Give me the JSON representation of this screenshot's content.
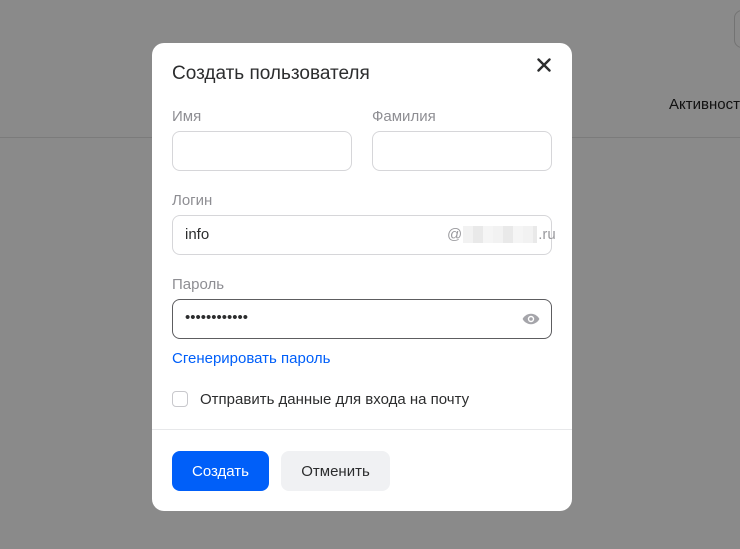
{
  "background": {
    "tab_label": "Активност"
  },
  "modal": {
    "title": "Создать пользователя",
    "close_icon": "close-icon",
    "first_name": {
      "label": "Имя",
      "value": ""
    },
    "last_name": {
      "label": "Фамилия",
      "value": ""
    },
    "login": {
      "label": "Логин",
      "value": "info",
      "domain_prefix": "@",
      "domain_suffix": ".ru"
    },
    "password": {
      "label": "Пароль",
      "masked_value": "••••••••••••",
      "toggle_icon": "eye-icon"
    },
    "generate_link": "Сгенерировать пароль",
    "send_checkbox": {
      "label": "Отправить данные для входа на почту",
      "checked": false
    },
    "buttons": {
      "create": "Создать",
      "cancel": "Отменить"
    }
  },
  "colors": {
    "primary": "#005ff9",
    "link": "#005ff9",
    "overlay": "rgba(0,0,0,0.46)",
    "secondary_button": "#f0f1f3"
  }
}
